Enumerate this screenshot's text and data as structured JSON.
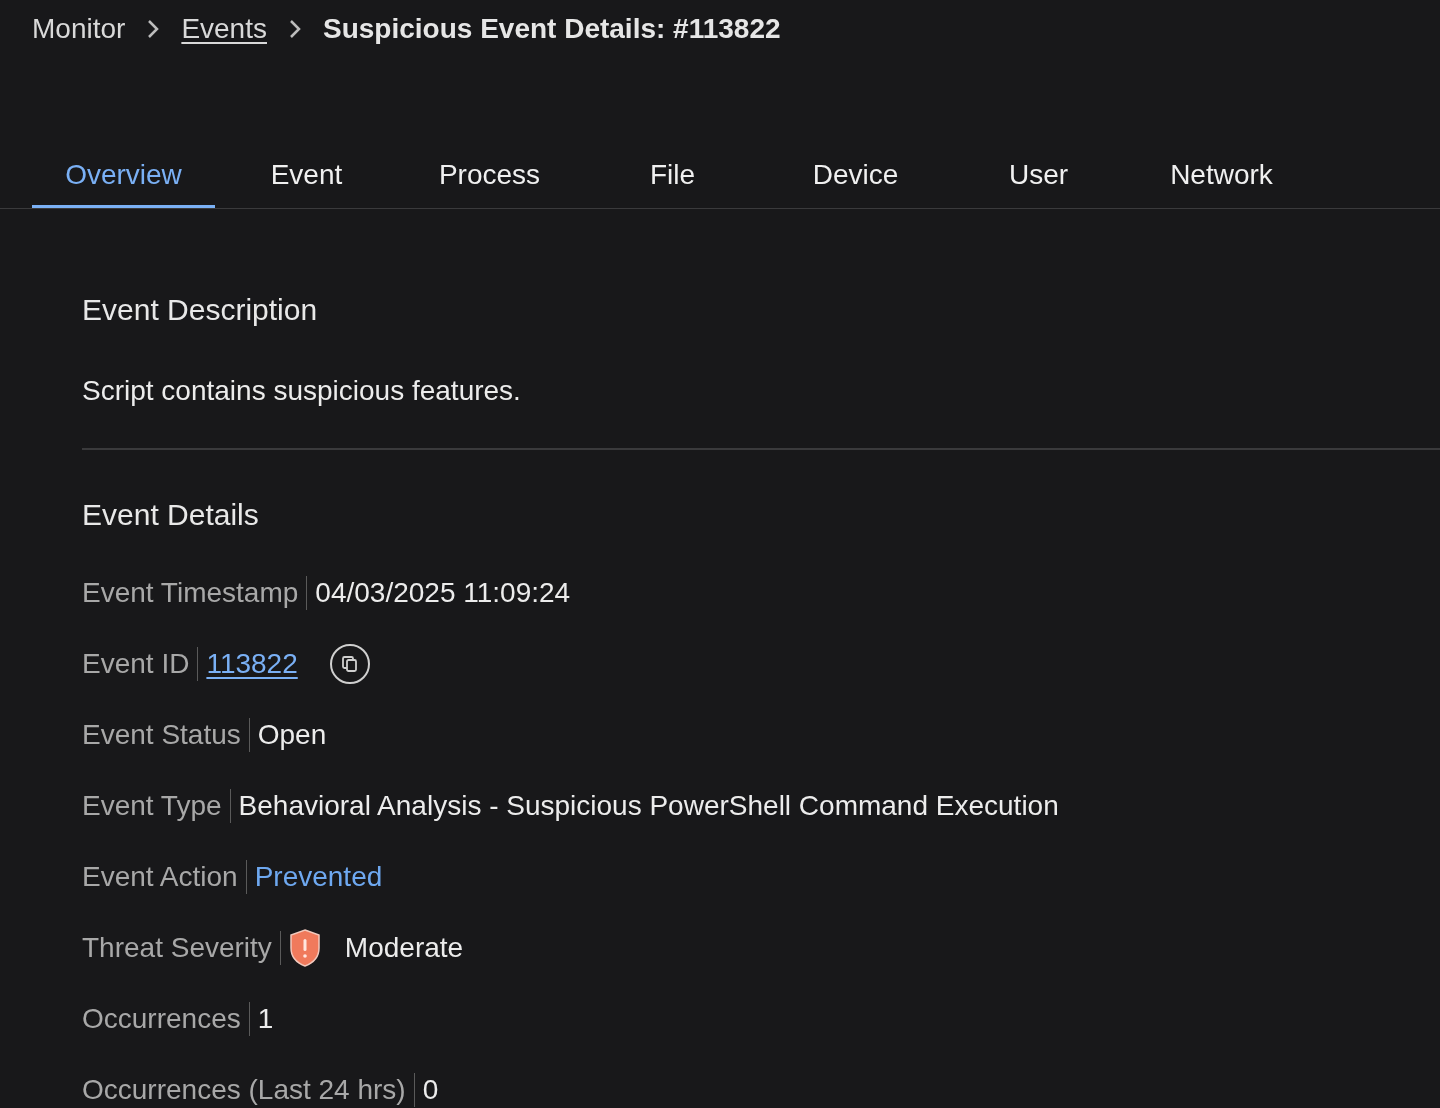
{
  "breadcrumb": [
    {
      "label": "Monitor",
      "kind": "text"
    },
    {
      "label": "Events",
      "kind": "link"
    },
    {
      "label": "Suspicious Event Details: #113822",
      "kind": "current"
    }
  ],
  "tabs": [
    {
      "label": "Overview",
      "selected": true
    },
    {
      "label": "Event",
      "selected": false
    },
    {
      "label": "Process",
      "selected": false
    },
    {
      "label": "File",
      "selected": false
    },
    {
      "label": "Device",
      "selected": false
    },
    {
      "label": "User",
      "selected": false
    },
    {
      "label": "Network",
      "selected": false
    }
  ],
  "description": {
    "title": "Event Description",
    "text": "Script contains suspicious features."
  },
  "details": {
    "title": "Event Details",
    "fields": [
      {
        "label": "Event Timestamp",
        "value": "04/03/2025 11:09:24",
        "kind": "text"
      },
      {
        "label": "Event ID",
        "value": "113822",
        "kind": "link"
      },
      {
        "label": "Event Status",
        "value": "Open",
        "kind": "text"
      },
      {
        "label": "Event Type",
        "value": "Behavioral Analysis - Suspicious PowerShell Command Execution",
        "kind": "text"
      },
      {
        "label": "Event Action",
        "value": "Prevented",
        "kind": "accent"
      },
      {
        "label": "Threat Severity",
        "value": "Moderate",
        "kind": "severity"
      },
      {
        "label": "Occurrences",
        "value": "1",
        "kind": "text"
      },
      {
        "label": "Occurrences (Last 24 hrs)",
        "value": "0",
        "kind": "text"
      }
    ]
  }
}
